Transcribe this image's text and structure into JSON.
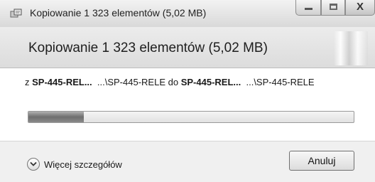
{
  "window": {
    "title": "Kopiowanie 1 323 elementów (5,02 MB)",
    "icon": "copy-files-icon"
  },
  "header": {
    "text": "Kopiowanie 1 323 elementów (5,02 MB)"
  },
  "path": {
    "prefix": "z",
    "source_bold": "SP-445-REL...",
    "source_path": "...\\SP-445-RELE",
    "connector": "do",
    "dest_bold": "SP-445-REL...",
    "dest_path": "...\\SP-445-RELE"
  },
  "progress": {
    "fraction": 0.17
  },
  "footer": {
    "more_details_label": "Więcej szczegółów",
    "cancel_label": "Anuluj"
  },
  "controls": {
    "minimize_icon": "minimize-icon",
    "maximize_icon": "maximize-icon",
    "close_icon": "close-icon",
    "close_glyph": "X"
  }
}
